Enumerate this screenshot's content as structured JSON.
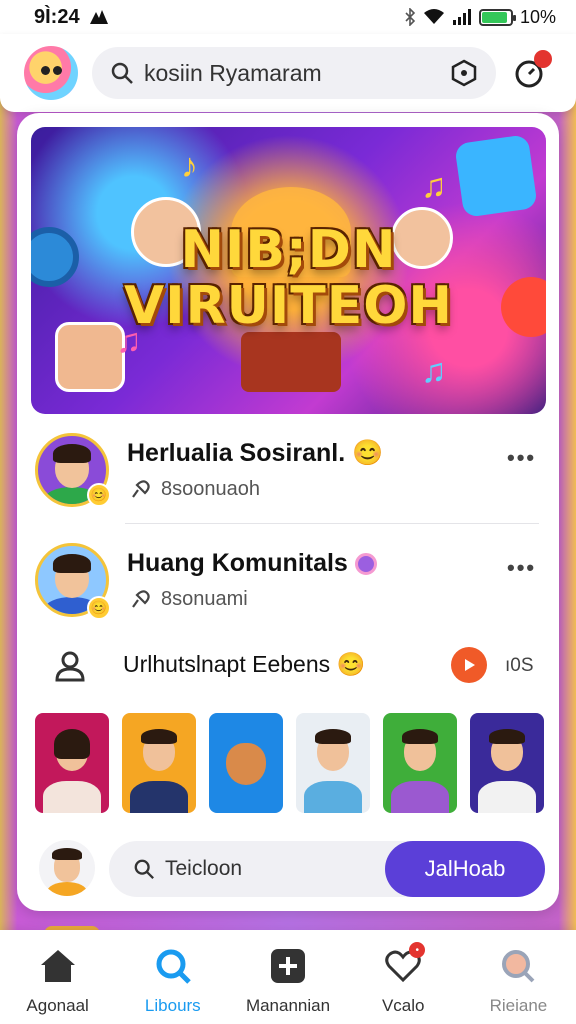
{
  "status": {
    "time": "9Ì:24",
    "battery": "10%"
  },
  "header": {
    "search_text": "kosiin Ryamaram",
    "notification_count": ""
  },
  "banner": {
    "title_line1": "NIB;DN",
    "title_line2": "VIRUITEOH"
  },
  "posts": [
    {
      "title": "Herlualia Sosiranl.",
      "subtitle": "8soonuaoh"
    },
    {
      "title": "Huang Komunitals",
      "subtitle": "8sonuami"
    }
  ],
  "event": {
    "title": "Urlhutslnapt Eebens",
    "count": "ı0S"
  },
  "compose": {
    "placeholder": "Teicloon",
    "button_label": "JalHoab"
  },
  "nav": [
    {
      "label": "Agonaal"
    },
    {
      "label": "Libours"
    },
    {
      "label": "Manannian"
    },
    {
      "label": "Vcalo"
    },
    {
      "label": "Rieiane"
    }
  ],
  "colors": {
    "accent": "#5b3fd8",
    "active_nav": "#1a9bf0",
    "badge": "#e3342f"
  }
}
